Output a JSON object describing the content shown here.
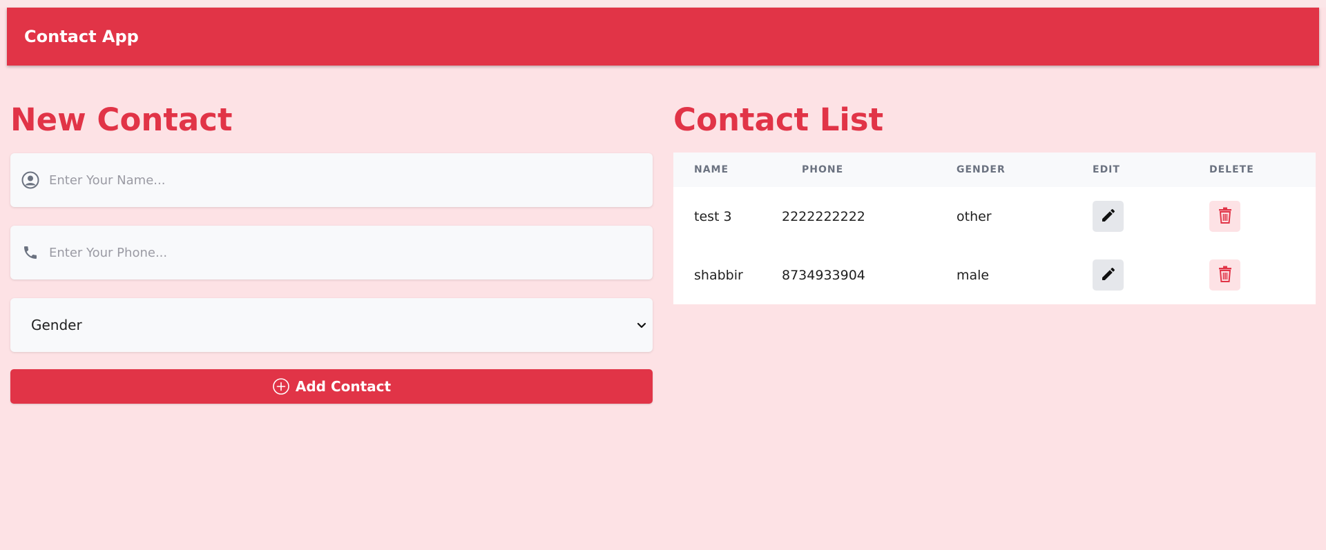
{
  "app": {
    "title": "Contact App"
  },
  "form": {
    "heading": "New Contact",
    "name_placeholder": "Enter Your Name...",
    "name_value": "",
    "phone_placeholder": "Enter Your Phone...",
    "phone_value": "",
    "gender_selected": "Gender",
    "add_label": "Add Contact",
    "icons": [
      "user-circle-icon",
      "phone-icon",
      "chevron-down-icon",
      "plus-circle-icon"
    ]
  },
  "list": {
    "heading": "Contact List",
    "columns": [
      "NAME",
      "PHONE",
      "GENDER",
      "EDIT",
      "DELETE"
    ],
    "rows": [
      {
        "name": "test 3",
        "phone": "2222222222",
        "gender": "other"
      },
      {
        "name": "shabbir",
        "phone": "8734933904",
        "gender": "male"
      }
    ],
    "icons": [
      "pencil-icon",
      "trash-icon"
    ]
  },
  "colors": {
    "accent": "#e13447",
    "background": "#fde2e5",
    "field": "#f8f9fb",
    "header_text": "#6b7280",
    "edit_button": "#e5e7eb",
    "delete_button": "#fde2e5"
  }
}
